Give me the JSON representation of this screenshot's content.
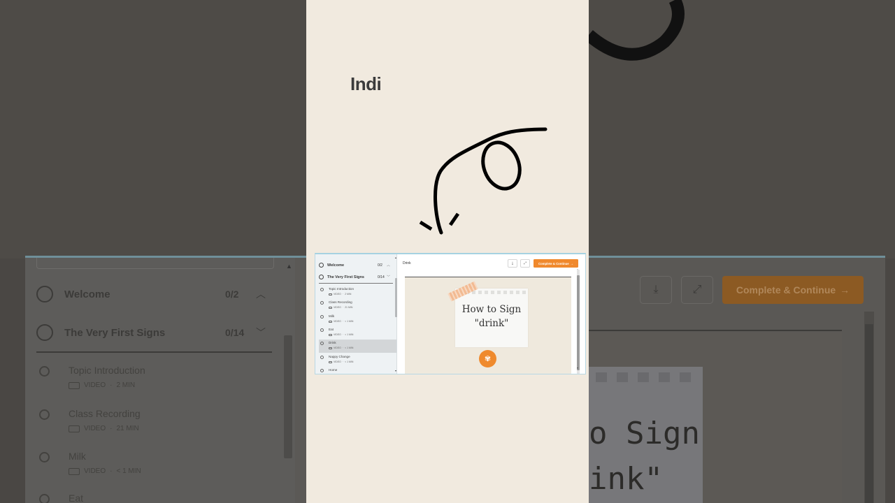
{
  "overlay_title": "Indi",
  "course": {
    "sections": [
      {
        "title": "Welcome",
        "count": "0/2",
        "chevron": "^"
      },
      {
        "title": "The Very First Signs",
        "count": "0/14",
        "chevron": "v"
      }
    ],
    "lessons": [
      {
        "title": "Topic Introduction",
        "meta_type": "VIDEO",
        "meta_length": "2 MIN"
      },
      {
        "title": "Class Recording",
        "meta_type": "VIDEO",
        "meta_length": "21 MIN"
      },
      {
        "title": "Milk",
        "meta_type": "VIDEO",
        "meta_length": "< 1 MIN"
      },
      {
        "title": "Eat",
        "meta_type": "VIDEO",
        "meta_length": "< 1 MIN"
      },
      {
        "title": "Drink",
        "meta_type": "VIDEO",
        "meta_length": "< 1 MIN"
      },
      {
        "title": "Nappy Change",
        "meta_type": "VIDEO",
        "meta_length": "< 1 MIN"
      },
      {
        "title": "Home",
        "meta_type": "",
        "meta_length": ""
      }
    ],
    "active_lesson": "Drink"
  },
  "main": {
    "lesson_title": "Drink",
    "complete_button": "Complete & Continue",
    "complete_arrow": "→",
    "video_caption_line1": "How to Sign",
    "video_caption_line2": "\"drink\""
  },
  "background_zoom": {
    "sign_text_1": "o Sign",
    "sign_text_2": "ink\""
  },
  "colors": {
    "accent_orange": "#f0892d",
    "cream": "#f1eadf",
    "border_blue": "#a6d2e1"
  },
  "icons": {
    "download": "download-icon",
    "expand": "expand-icon",
    "video": "video-camera-icon",
    "arrow": "curly-arrow-icon"
  }
}
